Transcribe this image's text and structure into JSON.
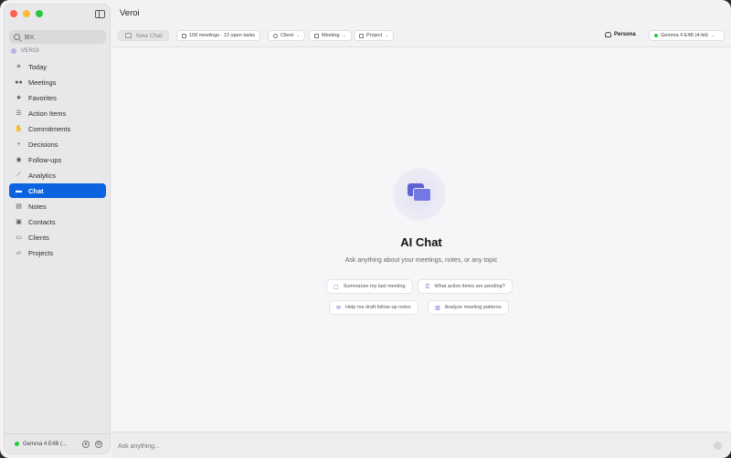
{
  "app": {
    "title": "Veroi"
  },
  "sidebar": {
    "search_placeholder": "⌘K",
    "workspace_label": "VEROI",
    "items": [
      {
        "label": "Today",
        "icon": "sun-icon",
        "active": false
      },
      {
        "label": "Meetings",
        "icon": "people-icon",
        "active": false
      },
      {
        "label": "Favorites",
        "icon": "star-icon",
        "active": false
      },
      {
        "label": "Action Items",
        "icon": "checklist-icon",
        "active": false
      },
      {
        "label": "Commitments",
        "icon": "hand-icon",
        "active": false
      },
      {
        "label": "Decisions",
        "icon": "branch-icon",
        "active": false
      },
      {
        "label": "Follow-ups",
        "icon": "followup-icon",
        "active": false
      },
      {
        "label": "Analytics",
        "icon": "chart-icon",
        "active": false
      },
      {
        "label": "Chat",
        "icon": "chat-bubbles-icon",
        "active": true
      },
      {
        "label": "Notes",
        "icon": "note-icon",
        "active": false
      },
      {
        "label": "Contacts",
        "icon": "contact-icon",
        "active": false
      },
      {
        "label": "Clients",
        "icon": "briefcase-icon",
        "active": false
      },
      {
        "label": "Projects",
        "icon": "folder-icon",
        "active": false
      }
    ],
    "footer_model": "Gemma 4 E4B (..."
  },
  "toolbar": {
    "new_chat": "New Chat",
    "stats": "108 meetings · 12 open tasks",
    "client_filter": "Client",
    "meeting_filter": "Meeting",
    "project_filter": "Project",
    "persona": "Persona",
    "model": "Gemma 4 E4B (4-bit)"
  },
  "hero": {
    "title": "AI Chat",
    "subtitle": "Ask anything about your meetings, notes, or any topic"
  },
  "suggestions": [
    "Summarize my last meeting",
    "What action items are pending?",
    "Help me draft follow-up notes",
    "Analyze meeting patterns"
  ],
  "input": {
    "placeholder": "Ask anything..."
  },
  "colors": {
    "accent": "#0b63e0",
    "chat_icon": "#5e62d4",
    "status_green": "#28c840"
  }
}
